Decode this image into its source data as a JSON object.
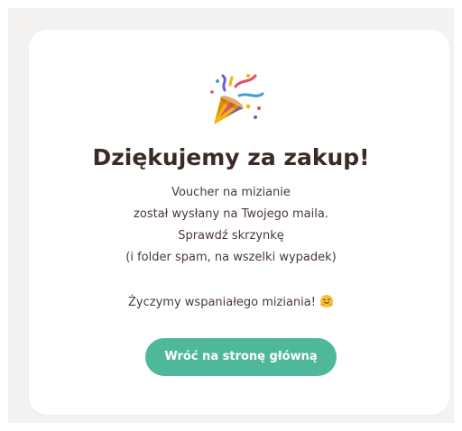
{
  "thank_you": {
    "icon": "party-popper-icon",
    "title": "Dziękujemy za zakup!",
    "message_lines": [
      "Voucher na mizianie",
      "został wysłany na Twojego maila.",
      "Sprawdź skrzynkę",
      "(i folder spam, na wszelki wypadek)"
    ],
    "wish": "Życzymy wspaniałego miziania!",
    "wish_icon": "hugging-face-icon",
    "button_label": "Wróć na stronę główną"
  },
  "colors": {
    "accent": "#4fb89b",
    "title": "#3b2a26",
    "text": "#4a3a36",
    "page_background": "#f4f2f1",
    "card": "#ffffff"
  }
}
